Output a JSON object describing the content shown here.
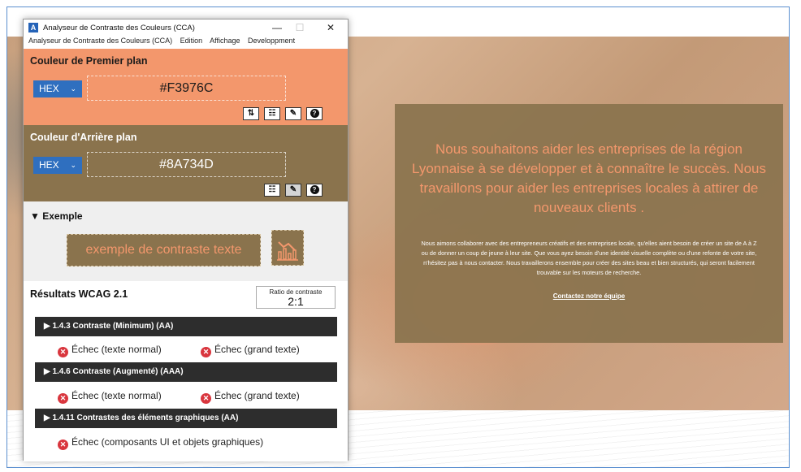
{
  "website": {
    "hero_heading": "Nous souhaitons aider les entreprises de la région Lyonnaise à se développer et à connaître le succès. Nous travaillons pour aider les entreprises locales à attirer de nouveaux clients .",
    "hero_body": "Nous aimons collaborer avec des entrepreneurs créatifs et des entreprises locale, qu'elles aient besoin de créer un site de A à Z ou de donner un coup de jeune à leur site. Que vous ayez besoin d'une identité visuelle complète ou d'une refonte de votre site, n'hésitez pas à nous contacter. Nous travaillerons ensemble pour créer des sites beau et bien structurés, qui seront facilement trouvable sur les moteurs de recherche.",
    "contact_link": "Contactez notre équipe"
  },
  "app": {
    "title": "Analyseur de Contraste des Couleurs (CCA)",
    "icon_glyph": "A",
    "window_controls": {
      "minimize": "—",
      "maximize": "☐",
      "close": "✕"
    },
    "menu": [
      "Analyseur de Contraste des Couleurs (CCA)",
      "Edition",
      "Affichage",
      "Developpment"
    ],
    "foreground": {
      "title": "Couleur de Premier plan",
      "format": "HEX",
      "value": "#F3976C",
      "tools": [
        "swap-icon",
        "sliders-icon",
        "eyedropper-icon",
        "help-icon"
      ]
    },
    "background": {
      "title": "Couleur d'Arrière plan",
      "format": "HEX",
      "value": "#8A734D",
      "tools": [
        "sliders-icon",
        "eyedropper-icon",
        "help-icon"
      ]
    },
    "example": {
      "title": "▼ Exemple",
      "sample_text": "exemple de contraste texte"
    },
    "results": {
      "title": "Résultats WCAG 2.1",
      "ratio_label": "Ratio de contraste",
      "ratio_value": "2:1",
      "criteria": [
        {
          "label": "▶  1.4.3 Contraste (Minimum) (AA)",
          "results": [
            "Échec (texte normal)",
            "Échec (grand texte)"
          ]
        },
        {
          "label": "▶  1.4.6 Contraste (Augmenté) (AAA)",
          "results": [
            "Échec (texte normal)",
            "Échec (grand texte)"
          ]
        },
        {
          "label": "▶  1.4.11 Contrastes des éléments graphiques (AA)",
          "results": [
            "Échec (composants UI et objets graphiques)"
          ]
        }
      ]
    }
  },
  "colors": {
    "foreground": "#F3976C",
    "background": "#8A734D",
    "fail": "#d9363e",
    "select": "#2f6fbf"
  }
}
